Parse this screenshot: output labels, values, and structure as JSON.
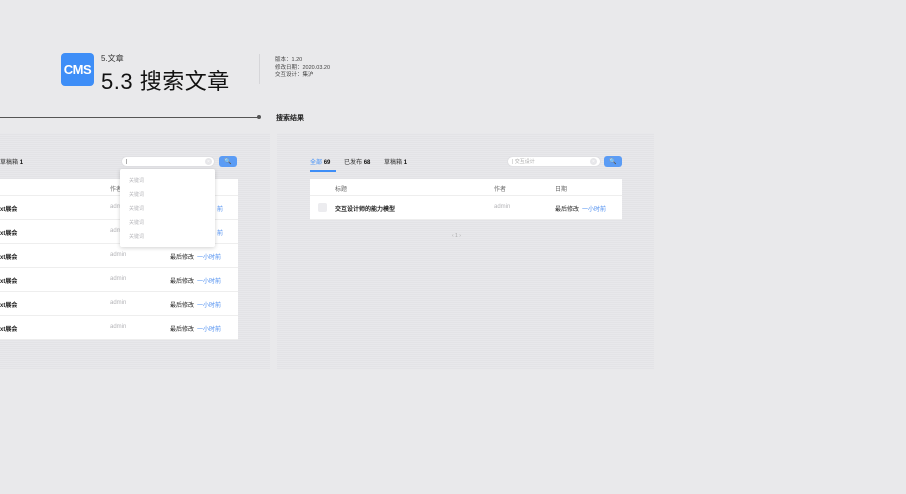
{
  "header": {
    "logo": "CMS",
    "section": "5.文章",
    "title": "5.3 搜索文章",
    "meta": [
      "版本：1.20",
      "修改日期：2020.03.20",
      "交互设计：集沪"
    ]
  },
  "annotation": {
    "label": "搜索结果"
  },
  "left_panel": {
    "filter_tab": "草稿箱",
    "filter_count": "1",
    "search": {
      "value": "|",
      "clear": "×",
      "button": "🔍"
    },
    "columns": {
      "author": "作者"
    },
    "dropdown": [
      "关键词",
      "关键词",
      "关键词",
      "关键词",
      "关键词"
    ],
    "rows": [
      {
        "title": "xt展会",
        "author": "adm",
        "date": "",
        "rel": "前"
      },
      {
        "title": "xt展会",
        "author": "adm",
        "date": "",
        "rel": "前"
      },
      {
        "title": "xt展会",
        "author": "admin",
        "date": "最后修改",
        "rel": "一小时前"
      },
      {
        "title": "xt展会",
        "author": "admin",
        "date": "最后修改",
        "rel": "一小时前"
      },
      {
        "title": "xt展会",
        "author": "admin",
        "date": "最后修改",
        "rel": "一小时前"
      },
      {
        "title": "xt展会",
        "author": "admin",
        "date": "最后修改",
        "rel": "一小时前"
      }
    ]
  },
  "right_panel": {
    "tabs": [
      {
        "label": "全部",
        "count": "69"
      },
      {
        "label": "已发布",
        "count": "68"
      },
      {
        "label": "草稿箱",
        "count": "1"
      }
    ],
    "search": {
      "value": "| 交互设计",
      "clear": "×",
      "button": "🔍"
    },
    "columns": {
      "title": "标题",
      "author": "作者",
      "date": "日期"
    },
    "rows": [
      {
        "title": "交互设计师的能力模型",
        "author": "admin",
        "date": "最后修改",
        "rel": "一小时前"
      }
    ],
    "pager": "‹  1  ›"
  }
}
